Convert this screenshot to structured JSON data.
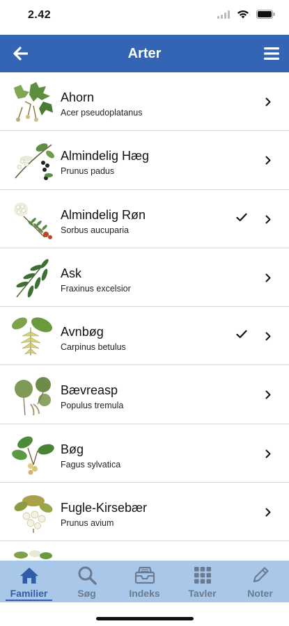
{
  "status_bar": {
    "time": "2.42"
  },
  "nav": {
    "title": "Arter"
  },
  "species": [
    {
      "name": "Ahorn",
      "latin": "Acer pseudoplatanus",
      "checked": false,
      "icon": "maple-illustration"
    },
    {
      "name": "Almindelig Hæg",
      "latin": "Prunus padus",
      "checked": false,
      "icon": "bird-cherry-illustration"
    },
    {
      "name": "Almindelig Røn",
      "latin": "Sorbus aucuparia",
      "checked": true,
      "icon": "rowan-illustration"
    },
    {
      "name": "Ask",
      "latin": "Fraxinus excelsior",
      "checked": false,
      "icon": "ash-illustration"
    },
    {
      "name": "Avnbøg",
      "latin": "Carpinus betulus",
      "checked": true,
      "icon": "hornbeam-illustration"
    },
    {
      "name": "Bævreasp",
      "latin": "Populus tremula",
      "checked": false,
      "icon": "aspen-illustration"
    },
    {
      "name": "Bøg",
      "latin": "Fagus sylvatica",
      "checked": false,
      "icon": "beech-illustration"
    },
    {
      "name": "Fugle-Kirsebær",
      "latin": "Prunus avium",
      "checked": false,
      "icon": "wild-cherry-illustration"
    }
  ],
  "tabs": [
    {
      "label": "Familier",
      "icon": "home-icon",
      "active": true
    },
    {
      "label": "Søg",
      "icon": "search-icon",
      "active": false
    },
    {
      "label": "Indeks",
      "icon": "inbox-icon",
      "active": false
    },
    {
      "label": "Tavler",
      "icon": "grid-icon",
      "active": false
    },
    {
      "label": "Noter",
      "icon": "pencil-icon",
      "active": false
    }
  ],
  "colors": {
    "nav_blue": "#3464b4",
    "tab_bar": "#a9c7e8",
    "tab_active": "#2f5da8",
    "tab_inactive": "#6b7a8f"
  }
}
